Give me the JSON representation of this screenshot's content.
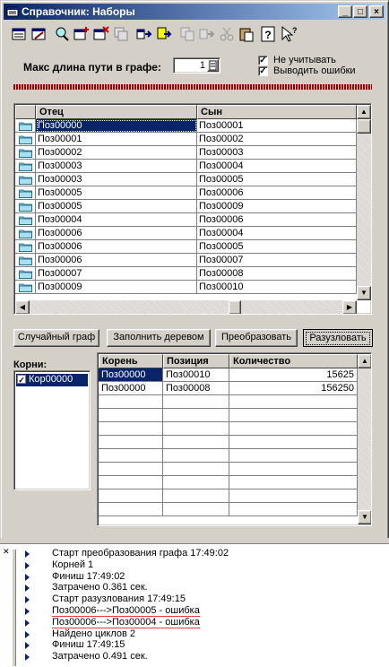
{
  "window": {
    "title": "Справочник: Наборы"
  },
  "toolbar": {
    "icons": [
      "open-table-icon",
      "edit-table-icon",
      "find-icon",
      "add-row-icon",
      "delete-row-icon",
      "copy-row-icon",
      "move-right-icon",
      "export-icon",
      "copy-icon",
      "forward-icon",
      "scissors-icon",
      "paste-icon",
      "help-icon",
      "pointer-help-icon"
    ]
  },
  "settings": {
    "max_path_label": "Макс длина пути в графе:",
    "max_path_value": "1",
    "ignore_label": "Не учитывать",
    "ignore_checked": true,
    "show_errors_label": "Выводить ошибки",
    "show_errors_checked": true
  },
  "pairs_grid": {
    "columns": [
      "Отец",
      "Сын"
    ],
    "rows": [
      [
        "Поз00000",
        "Поз00001"
      ],
      [
        "Поз00001",
        "Поз00002"
      ],
      [
        "Поз00002",
        "Поз00003"
      ],
      [
        "Поз00003",
        "Поз00004"
      ],
      [
        "Поз00003",
        "Поз00005"
      ],
      [
        "Поз00005",
        "Поз00006"
      ],
      [
        "Поз00005",
        "Поз00009"
      ],
      [
        "Поз00004",
        "Поз00006"
      ],
      [
        "Поз00006",
        "Поз00004"
      ],
      [
        "Поз00006",
        "Поз00005"
      ],
      [
        "Поз00006",
        "Поз00007"
      ],
      [
        "Поз00007",
        "Поз00008"
      ],
      [
        "Поз00009",
        "Поз00010"
      ]
    ],
    "selected_row": 0
  },
  "buttons": {
    "random_graph": "Случайный граф",
    "fill_tree": "Заполнить деревом",
    "transform": "Преобразовать",
    "expand": "Разузловать"
  },
  "roots": {
    "label": "Корни:",
    "items": [
      {
        "label": "Кор00000",
        "checked": true
      }
    ]
  },
  "results_grid": {
    "columns": [
      "Корень",
      "Позиция",
      "Количество"
    ],
    "rows": [
      [
        "Поз00000",
        "Поз00010",
        "15625"
      ],
      [
        "Поз00000",
        "Поз00008",
        "156250"
      ]
    ]
  },
  "log": {
    "lines": [
      "Старт преобразования графа 17:49:02",
      "Корней 1",
      "Финиш 17:49:02",
      "Затрачено 0.361 сек.",
      "Старт разузлования 17:49:15",
      "Поз00006--->Поз00005 - ошибка",
      "Поз00006--->Поз00004 - ошибка",
      "Найдено циклов 2",
      "Финиш 17:49:15",
      "Затрачено 0.491 сек."
    ]
  },
  "colors": {
    "title_bar": "#0a246a",
    "selection": "#0a246a",
    "separator": "#a00000",
    "error_underline": "#e04040"
  }
}
